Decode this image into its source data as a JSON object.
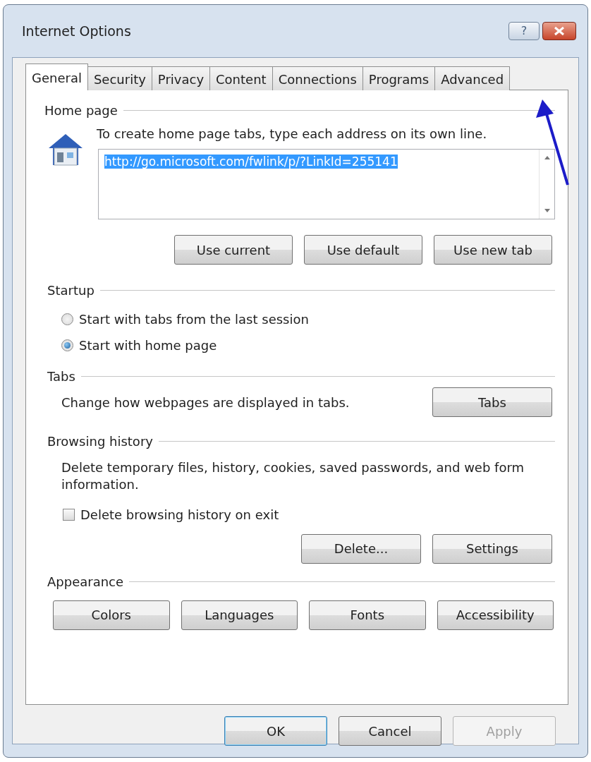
{
  "window": {
    "title": "Internet Options",
    "help_label": "?"
  },
  "tabs": [
    {
      "label": "General",
      "selected": true
    },
    {
      "label": "Security",
      "selected": false
    },
    {
      "label": "Privacy",
      "selected": false
    },
    {
      "label": "Content",
      "selected": false
    },
    {
      "label": "Connections",
      "selected": false
    },
    {
      "label": "Programs",
      "selected": false
    },
    {
      "label": "Advanced",
      "selected": false
    }
  ],
  "callout_arrow": true,
  "home_page": {
    "title": "Home page",
    "hint": "To create home page tabs, type each address on its own line.",
    "value": "http://go.microsoft.com/fwlink/p/?LinkId=255141",
    "text_selected": true,
    "buttons": [
      "Use current",
      "Use default",
      "Use new tab"
    ]
  },
  "startup": {
    "title": "Startup",
    "options": [
      {
        "label": "Start with tabs from the last session",
        "selected": false
      },
      {
        "label": "Start with home page",
        "selected": true
      }
    ]
  },
  "tabs_section": {
    "title": "Tabs",
    "description": "Change how webpages are displayed in tabs.",
    "button": "Tabs"
  },
  "browsing_history": {
    "title": "Browsing history",
    "description": "Delete temporary files, history, cookies, saved passwords, and web form information.",
    "checkbox": {
      "label": "Delete browsing history on exit",
      "checked": false
    },
    "buttons": [
      "Delete...",
      "Settings"
    ]
  },
  "appearance": {
    "title": "Appearance",
    "buttons": [
      "Colors",
      "Languages",
      "Fonts",
      "Accessibility"
    ]
  },
  "footer_buttons": [
    {
      "label": "OK",
      "default": true,
      "disabled": false
    },
    {
      "label": "Cancel",
      "default": false,
      "disabled": false
    },
    {
      "label": "Apply",
      "default": false,
      "disabled": true
    }
  ]
}
